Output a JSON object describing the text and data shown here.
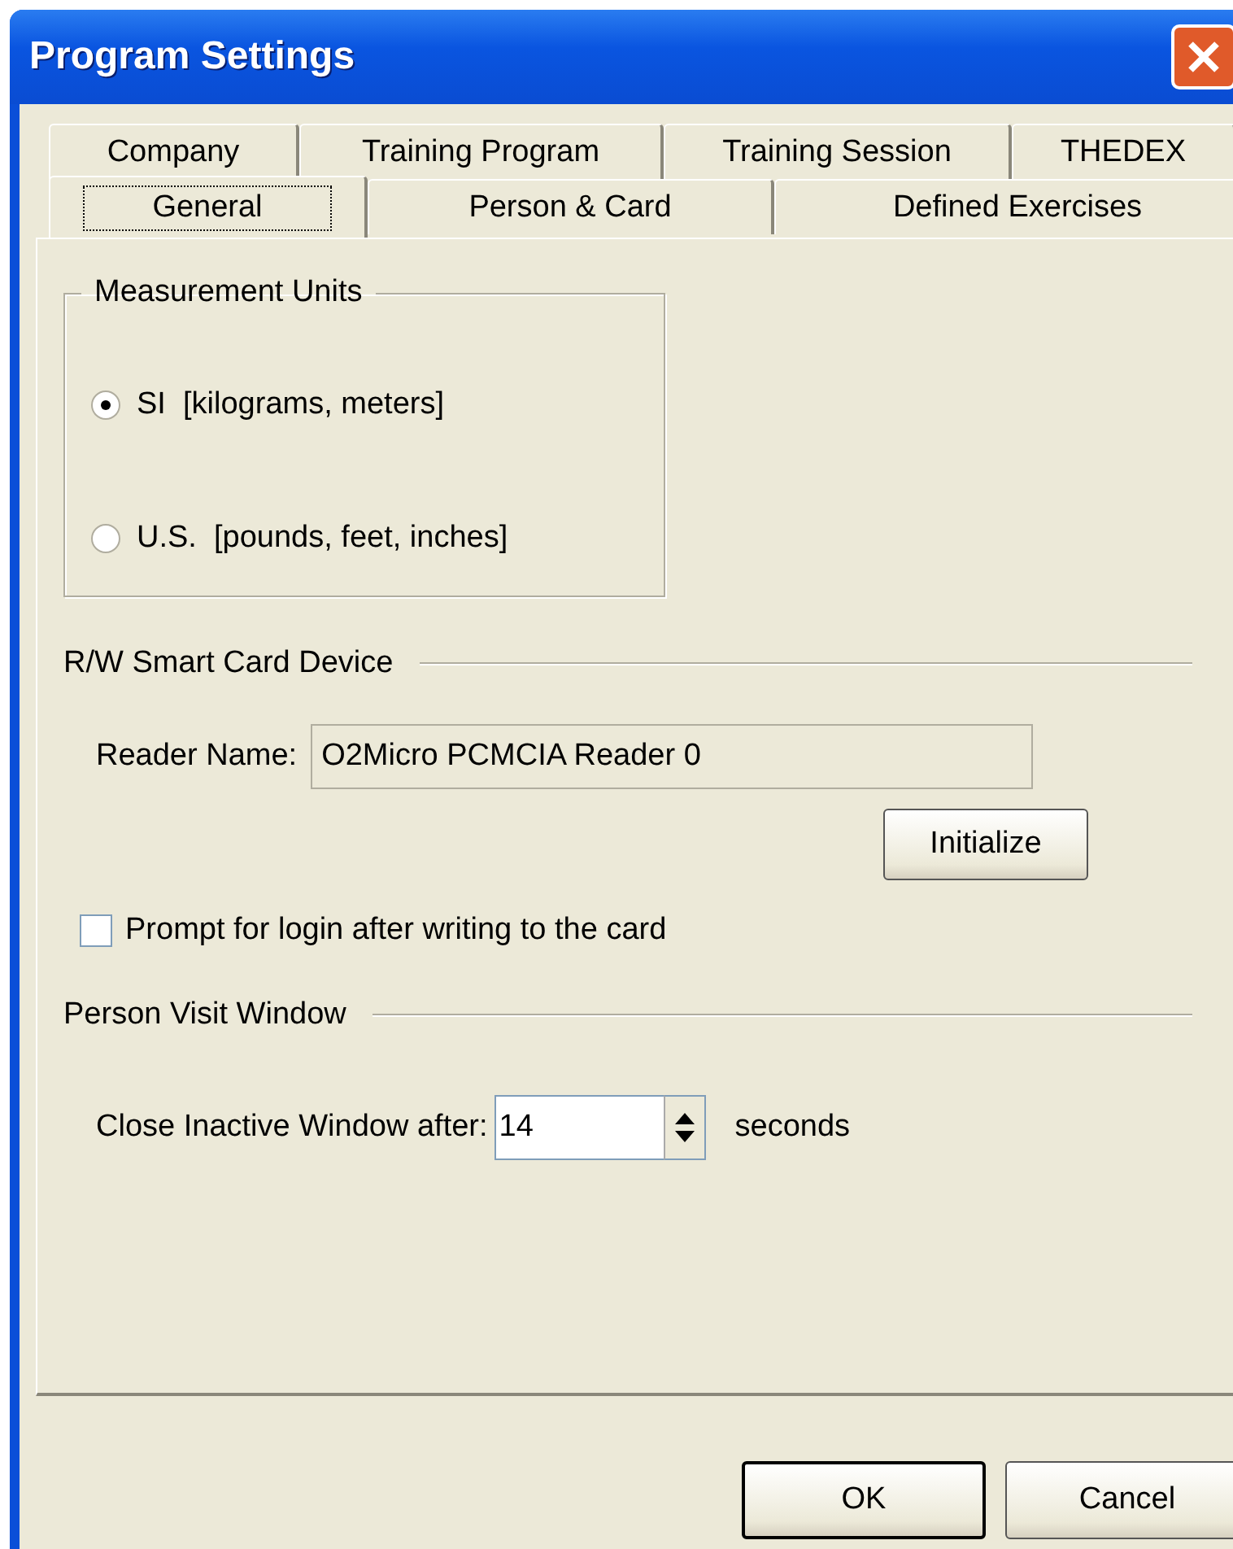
{
  "window": {
    "title": "Program Settings"
  },
  "tab_rows": [
    {
      "tabs": [
        {
          "label": "Company",
          "selected": false
        },
        {
          "label": "Training Program",
          "selected": false
        },
        {
          "label": "Training Session",
          "selected": false
        },
        {
          "label": "THEDEX",
          "selected": false
        }
      ]
    },
    {
      "tabs": [
        {
          "label": "General",
          "selected": true
        },
        {
          "label": "Person & Card",
          "selected": false
        },
        {
          "label": "Defined Exercises",
          "selected": false
        }
      ]
    }
  ],
  "measurement_units": {
    "title": "Measurement Units",
    "options": [
      {
        "label": "SI  [kilograms, meters]",
        "selected": true
      },
      {
        "label": "U.S.  [pounds, feet, inches]",
        "selected": false
      }
    ]
  },
  "smart_card": {
    "title": "R/W Smart Card Device",
    "reader_label": "Reader Name:",
    "reader_value": "O2Micro PCMCIA Reader 0",
    "button": "Initialize"
  },
  "prompt_login": {
    "label": "Prompt for login after writing to the card",
    "checked": false
  },
  "person_visit": {
    "title": "Person Visit Window",
    "label": "Close Inactive Window after:",
    "value": "14",
    "unit": "seconds"
  },
  "buttons": [
    {
      "label": "OK",
      "default": true
    },
    {
      "label": "Cancel",
      "default": false
    }
  ]
}
